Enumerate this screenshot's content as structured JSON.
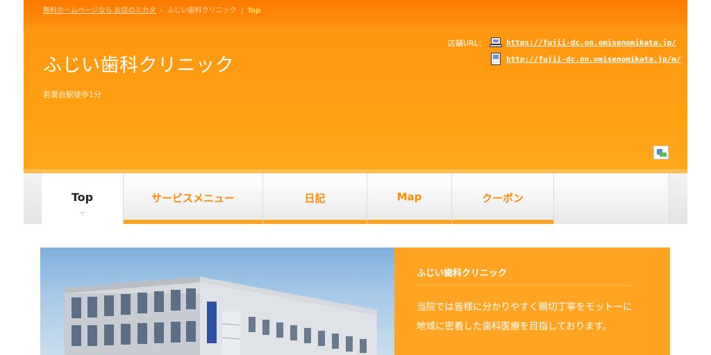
{
  "breadcrumb": {
    "home_link": "無料ホームページなら お店のミカタ",
    "sep1": "›",
    "shop_link": "ふじい歯科クリニック",
    "sep2": "|",
    "current": "Top"
  },
  "header": {
    "shop_name": "ふじい歯科クリニック",
    "tagline": "若葉台駅徒歩1分",
    "url_label": "店舗URL：",
    "pc_url": "https://fujii-dc.on.omisenomikata.jp/",
    "mobile_url": "http://fujii-dc.on.omisenomikata.jp/m/",
    "pc_icon": "computer-icon",
    "mobile_icon": "mobile-phone-icon"
  },
  "nav": {
    "items": [
      {
        "label": "Top",
        "active": true,
        "marker": "∵"
      },
      {
        "label": "サービスメニュー"
      },
      {
        "label": "日記"
      },
      {
        "label": "Map"
      },
      {
        "label": "クーポン"
      }
    ]
  },
  "intro": {
    "title": "ふじい歯科クリニック",
    "text": "当院では皆様に分かりやすく親切丁寧をモットーに地域に密着した歯科医療を目指しております。"
  },
  "colors": {
    "accent": "#ffa21c",
    "header_top": "#ff7a00",
    "nav_text": "#ff8c00"
  }
}
